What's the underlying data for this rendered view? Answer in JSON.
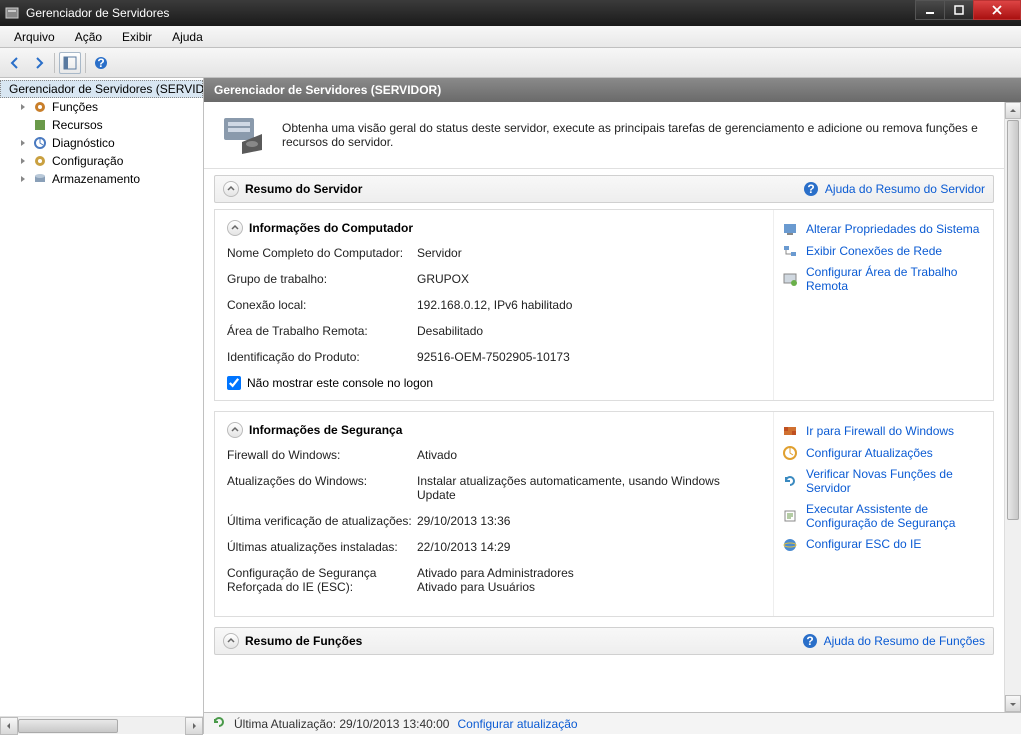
{
  "window": {
    "title": "Gerenciador de Servidores"
  },
  "menu": {
    "arquivo": "Arquivo",
    "acao": "Ação",
    "exibir": "Exibir",
    "ajuda": "Ajuda"
  },
  "tree": {
    "root": "Gerenciador de Servidores (SERVIDOR)",
    "funcoes": "Funções",
    "recursos": "Recursos",
    "diagnostico": "Diagnóstico",
    "configuracao": "Configuração",
    "armazenamento": "Armazenamento"
  },
  "header": {
    "title": "Gerenciador de Servidores (SERVIDOR)"
  },
  "banner": {
    "text": "Obtenha uma visão geral do status deste servidor, execute as principais tarefas de gerenciamento e adicione ou remova funções e recursos do servidor."
  },
  "section1": {
    "title": "Resumo do Servidor",
    "help": "Ajuda do Resumo do Servidor"
  },
  "compinfo": {
    "title": "Informações do Computador",
    "k_fullname": "Nome Completo do Computador:",
    "v_fullname": "Servidor",
    "k_workgroup": "Grupo de trabalho:",
    "v_workgroup": "GRUPOX",
    "k_localconn": "Conexão local:",
    "v_localconn": "192.168.0.12, IPv6 habilitado",
    "k_remote": "Área de Trabalho Remota:",
    "v_remote": "Desabilitado",
    "k_productid": "Identificação do Produto:",
    "v_productid": "92516-OEM-7502905-10173",
    "chk_label": "Não mostrar este console no logon",
    "action1": "Alterar Propriedades do Sistema",
    "action2": "Exibir Conexões de Rede",
    "action3": "Configurar Área de Trabalho Remota"
  },
  "secinfo": {
    "title": "Informações de Segurança",
    "k_firewall": "Firewall do Windows:",
    "v_firewall": "Ativado",
    "k_updates": "Atualizações do Windows:",
    "v_updates": "Instalar atualizações automaticamente, usando Windows Update",
    "k_lastcheck": "Última verificação de atualizações:",
    "v_lastcheck": "29/10/2013 13:36",
    "k_lastinstall": "Últimas atualizações instaladas:",
    "v_lastinstall": "22/10/2013 14:29",
    "k_iesec": "Configuração de Segurança Reforçada do IE (ESC):",
    "v_iesec1": "Ativado para Administradores",
    "v_iesec2": "Ativado para Usuários",
    "action1": "Ir para Firewall do Windows",
    "action2": "Configurar Atualizações",
    "action3": "Verificar Novas Funções de Servidor",
    "action4": "Executar Assistente de Configuração de Segurança",
    "action5": "Configurar ESC do IE"
  },
  "section2": {
    "title": "Resumo de Funções",
    "help": "Ajuda do Resumo de Funções"
  },
  "status": {
    "label": "Última Atualização: 29/10/2013 13:40:00",
    "link": "Configurar atualização"
  }
}
